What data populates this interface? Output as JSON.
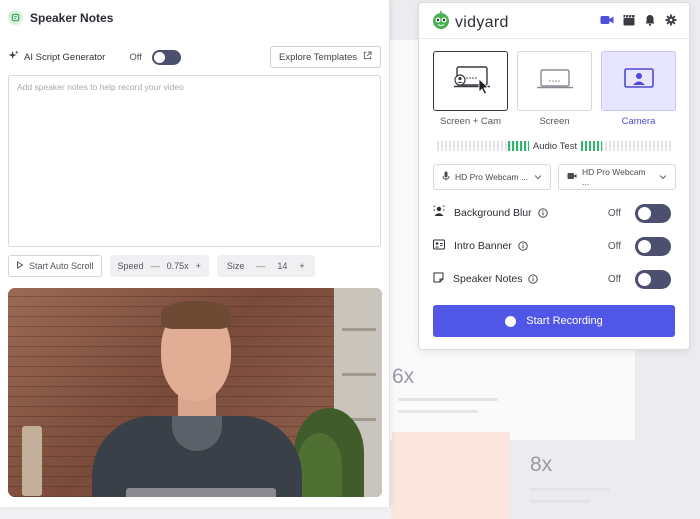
{
  "background": {
    "speed_a": "6x",
    "speed_b": "8x"
  },
  "notes": {
    "title": "Speaker Notes",
    "ai_label": "AI Script Generator",
    "ai_state": "Off",
    "explore_label": "Explore Templates",
    "placeholder": "Add speaker notes to help record your video",
    "auto_scroll_label": "Start Auto Scroll",
    "speed_label": "Speed",
    "speed_minus": "—",
    "speed_value": "0.75x",
    "speed_plus": "+",
    "size_label": "Size",
    "size_minus": "—",
    "size_value": "14",
    "size_plus": "+"
  },
  "recorder": {
    "brand": "vidyard",
    "modes": [
      {
        "label": "Screen + Cam",
        "state": "selected"
      },
      {
        "label": "Screen",
        "state": "default"
      },
      {
        "label": "Camera",
        "state": "active"
      }
    ],
    "audio_label": "Audio Test",
    "mic_select": "HD Pro Webcam ...",
    "cam_select": "HD Pro Webcam ...",
    "options": [
      {
        "label": "Background Blur",
        "state": "Off",
        "icon": "blur-icon"
      },
      {
        "label": "Intro Banner",
        "state": "Off",
        "icon": "banner-icon"
      },
      {
        "label": "Speaker Notes",
        "state": "Off",
        "icon": "notes-icon"
      }
    ],
    "start_label": "Start Recording"
  },
  "colors": {
    "accent": "#5057e6",
    "toggle": "#4d4f6e",
    "active_mode_bg": "#e8e6ff",
    "audio_green": "#2fb86b",
    "brand_green": "#4caf50"
  }
}
